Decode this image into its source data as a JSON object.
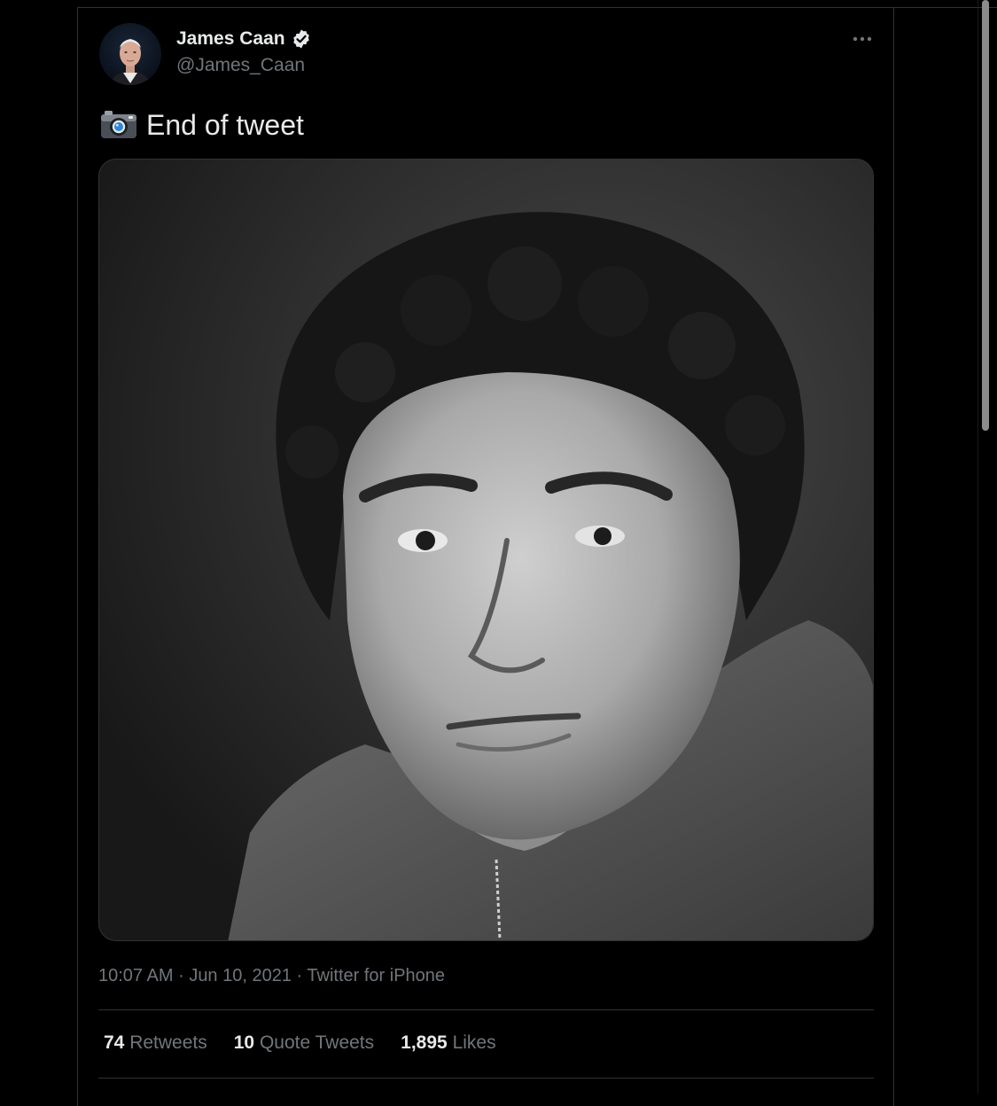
{
  "author": {
    "display_name": "James Caan",
    "handle": "@James_Caan",
    "verified": true,
    "avatar_icon": "user-avatar-photo"
  },
  "tweet": {
    "emoji_icon": "camera-with-flash-icon",
    "text": "End of tweet",
    "photo_description_icon": "black-and-white-portrait-photo"
  },
  "meta": {
    "time": "10:07 AM",
    "separator": "·",
    "date": "Jun 10, 2021",
    "source": "Twitter for iPhone"
  },
  "stats": {
    "retweets_count": "74",
    "retweets_label": "Retweets",
    "quote_count": "10",
    "quote_label": "Quote Tweets",
    "likes_count": "1,895",
    "likes_label": "Likes"
  },
  "colors": {
    "background": "#000000",
    "primary_text": "#e7e9ea",
    "secondary_text": "#71767b",
    "border": "#2f3336",
    "verified_badge": "#e7e9ea"
  }
}
